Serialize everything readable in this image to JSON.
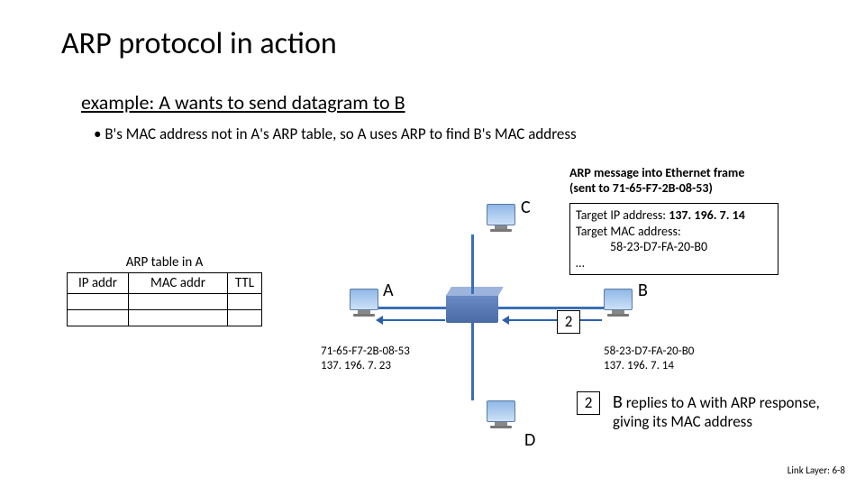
{
  "title": "ARP protocol in action",
  "subtitle": "example: A wants to send datagram to B",
  "bullet": "B's MAC address not in A's ARP table, so A uses ARP to find B's MAC address",
  "arp_table": {
    "title": "ARP table in A",
    "cols": {
      "ip": "IP addr",
      "mac": "MAC addr",
      "ttl": "TTL"
    }
  },
  "nodes": {
    "A": "A",
    "B": "B",
    "C": "C",
    "D": "D"
  },
  "step2a": "2",
  "step2b": "2",
  "msg": {
    "title_l1": "ARP message into Ethernet frame",
    "title_l2": "(sent to 71-65-F7-2B-08-53)",
    "tip_label": "Target IP address:",
    "tip": "137. 196. 7. 14",
    "tmac_label": "Target MAC address:",
    "tmac": "58-23-D7-FA-20-B0",
    "dots": "…"
  },
  "addr_a": {
    "mac": "71-65-F7-2B-08-53",
    "ip": "137. 196. 7. 23"
  },
  "addr_b": {
    "mac": "58-23-D7-FA-20-B0",
    "ip": "137. 196. 7. 14"
  },
  "reply": {
    "B": "B",
    "rest": " replies to A with ARP response, giving its MAC address"
  },
  "footer": "Link Layer: 6-8"
}
